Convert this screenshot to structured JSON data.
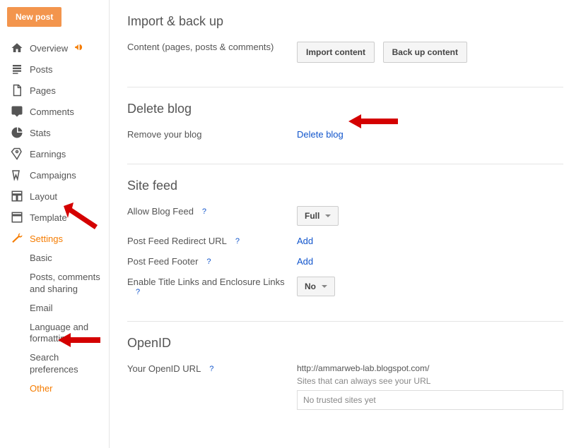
{
  "sidebar": {
    "new_post": "New post",
    "items": [
      {
        "label": "Overview"
      },
      {
        "label": "Posts"
      },
      {
        "label": "Pages"
      },
      {
        "label": "Comments"
      },
      {
        "label": "Stats"
      },
      {
        "label": "Earnings"
      },
      {
        "label": "Campaigns"
      },
      {
        "label": "Layout"
      },
      {
        "label": "Template"
      },
      {
        "label": "Settings"
      }
    ],
    "sub_items": [
      {
        "label": "Basic"
      },
      {
        "label": "Posts, comments and sharing"
      },
      {
        "label": "Email"
      },
      {
        "label": "Language and formatting"
      },
      {
        "label": "Search preferences"
      },
      {
        "label": "Other"
      }
    ]
  },
  "import": {
    "title": "Import & back up",
    "label": "Content (pages, posts & comments)",
    "btn_import": "Import content",
    "btn_backup": "Back up content"
  },
  "delete": {
    "title": "Delete blog",
    "label": "Remove your blog",
    "link": "Delete blog"
  },
  "sitefeed": {
    "title": "Site feed",
    "allow_label": "Allow Blog Feed",
    "allow_value": "Full",
    "redirect_label": "Post Feed Redirect URL",
    "redirect_value": "Add",
    "footer_label": "Post Feed Footer",
    "footer_value": "Add",
    "enclosure_label": "Enable Title Links and Enclosure Links",
    "enclosure_value": "No",
    "help": "?"
  },
  "openid": {
    "title": "OpenID",
    "url_label": "Your OpenID URL",
    "url_value": "http://ammarweb-lab.blogspot.com/",
    "sites_label": "Sites that can always see your URL",
    "trusted": "No trusted sites yet",
    "help": "?"
  }
}
